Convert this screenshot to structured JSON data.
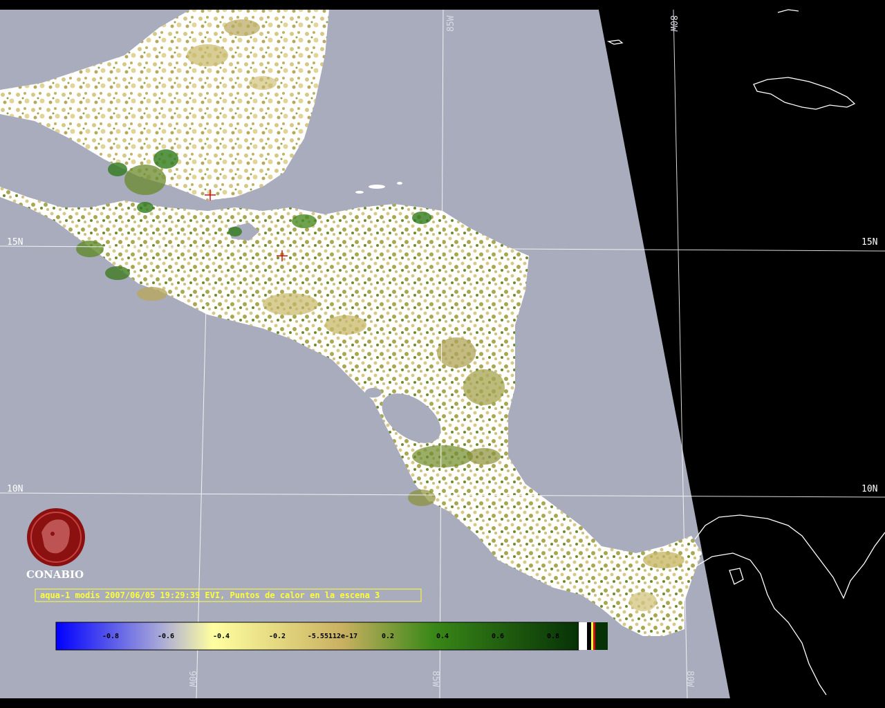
{
  "caption": "aqua-1 modis 2007/06/05 19:29:39 EVI, Puntos de calor en la escena 3",
  "logo": {
    "text": "CONABIO",
    "icon": "conabio-logo-icon"
  },
  "grid_labels": {
    "lat_15_left": "15N",
    "lat_15_right": "15N",
    "lat_10_left": "10N",
    "lat_10_right": "10N",
    "lon_85_top": "85W",
    "lon_80_top": "80W",
    "lon_90_bottom": "90W",
    "lon_85_bottom": "85W",
    "lon_80_bottom": "80W"
  },
  "colorbar": {
    "ticks": [
      "-0.8",
      "-0.6",
      "-0.4",
      "-0.2",
      "-5.55112e-17",
      "0.2",
      "0.4",
      "0.6",
      "0.8"
    ],
    "colors": [
      "#0000ff",
      "#a8a8d8",
      "#ffffa0",
      "#c8b060",
      "#2a7a10",
      "#083a08"
    ]
  },
  "colors": {
    "water": "#a8acbc",
    "land_cloud": "#ffffff",
    "vegetation_low": "#c8b868",
    "vegetation_high": "#2f7a1a",
    "outside_swath": "#000000",
    "caption": "#ffff33",
    "logo": "#8b1010"
  }
}
